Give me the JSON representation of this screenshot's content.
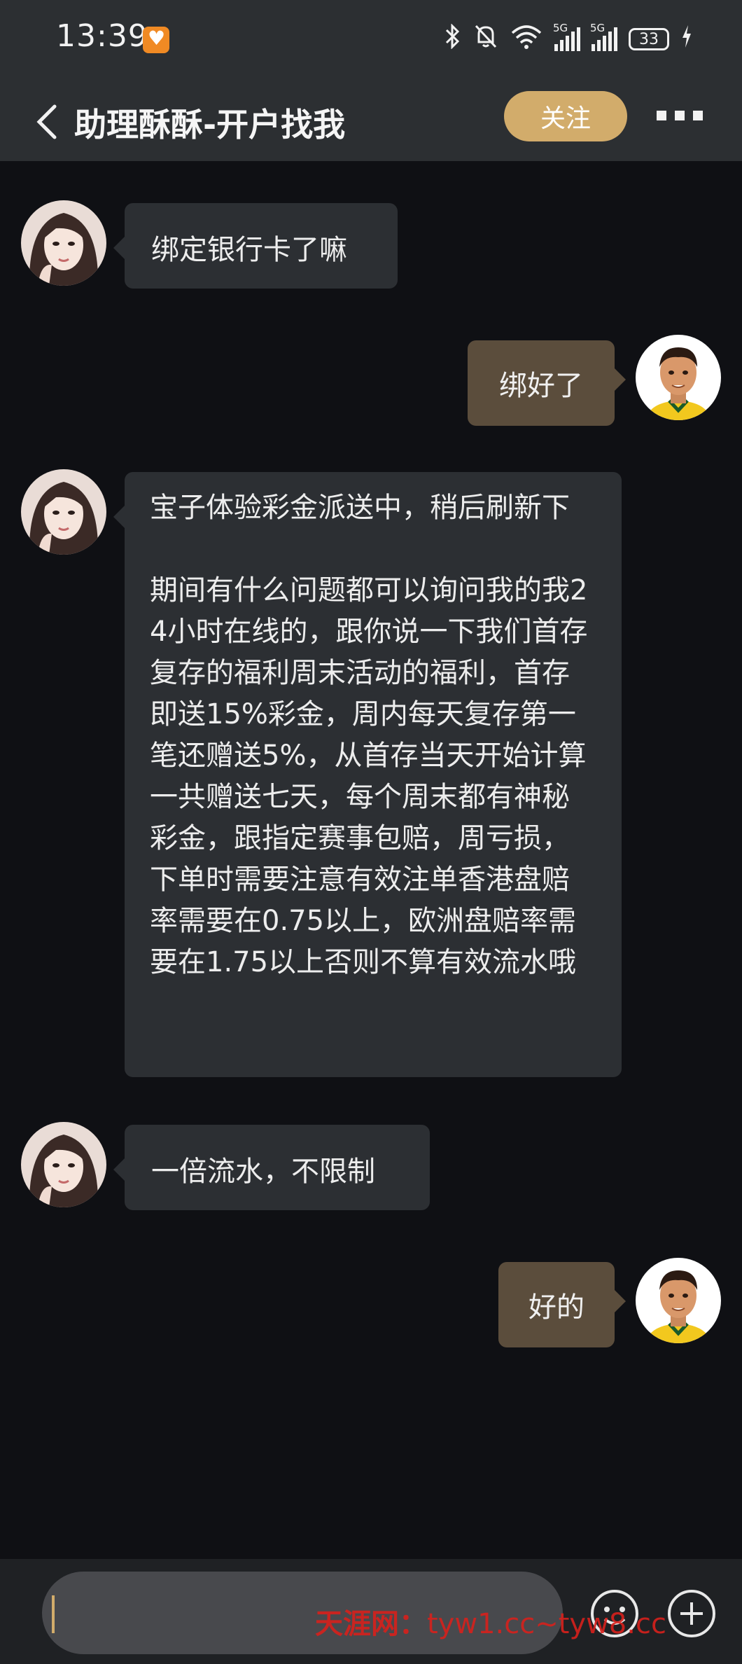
{
  "status_bar": {
    "time": "13:39",
    "network_1": "5G",
    "network_2": "5G",
    "battery": "33",
    "icons": [
      "bluetooth-icon",
      "mute-icon",
      "wifi-icon",
      "signal-icon",
      "signal-icon",
      "battery-icon",
      "charging-icon"
    ]
  },
  "header": {
    "title": "助理酥酥-开户找我",
    "follow_label": "关注"
  },
  "messages": [
    {
      "sender": "other",
      "text": "绑定银行卡了嘛"
    },
    {
      "sender": "me",
      "text": "绑好了"
    },
    {
      "sender": "other",
      "text": "宝子体验彩金派送中，稍后刷新下\n\n期间有什么问题都可以询问我的我24小时在线的，跟你说一下我们首存复存的福利周末活动的福利，首存即送15%彩金，周内每天复存第一笔还赠送5%，从首存当天开始计算一共赠送七天，每个周末都有神秘彩金，跟指定赛事包赔，周亏损，下单时需要注意有效注单香港盘赔率需要在0.75以上，欧洲盘赔率需要在1.75以上否则不算有效流水哦"
    },
    {
      "sender": "other",
      "text": "一倍流水，不限制"
    },
    {
      "sender": "me",
      "text": "好的"
    }
  ],
  "input": {
    "placeholder": "",
    "value": ""
  },
  "watermark": {
    "brand": "天涯网：",
    "url": "tyw1.cc~tyw8.cc"
  },
  "colors": {
    "accent": "#d2ac6b",
    "outgoing_bubble": "#5b4d3c",
    "incoming_bubble": "#2c2f33",
    "background": "#0f1014"
  }
}
